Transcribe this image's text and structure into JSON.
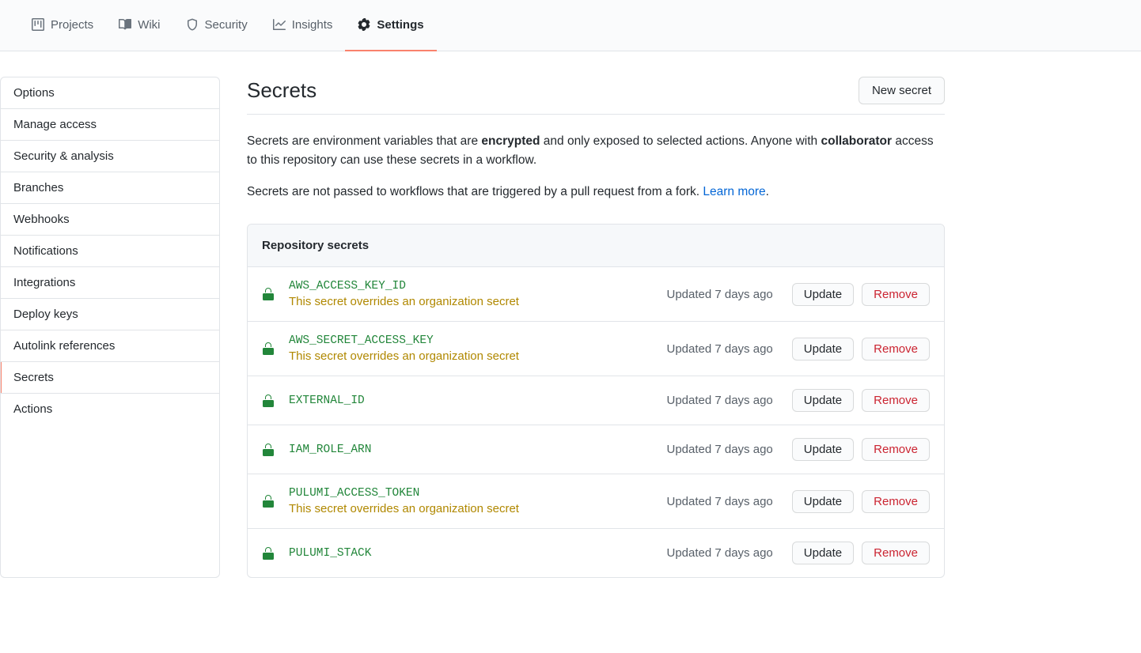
{
  "topnav": {
    "tabs": [
      {
        "label": "Projects",
        "icon": "project-icon"
      },
      {
        "label": "Wiki",
        "icon": "book-icon"
      },
      {
        "label": "Security",
        "icon": "shield-icon"
      },
      {
        "label": "Insights",
        "icon": "graph-icon"
      },
      {
        "label": "Settings",
        "icon": "gear-icon"
      }
    ],
    "active_index": 4
  },
  "sidebar": {
    "items": [
      "Options",
      "Manage access",
      "Security & analysis",
      "Branches",
      "Webhooks",
      "Notifications",
      "Integrations",
      "Deploy keys",
      "Autolink references",
      "Secrets",
      "Actions"
    ],
    "active_index": 9
  },
  "main": {
    "title": "Secrets",
    "new_button": "New secret",
    "desc1_parts": {
      "a": "Secrets are environment variables that are ",
      "b": "encrypted",
      "c": " and only exposed to selected actions. Anyone with ",
      "d": "collaborator",
      "e": " access to this repository can use these secrets in a workflow."
    },
    "desc2_parts": {
      "a": "Secrets are not passed to workflows that are triggered by a pull request from a fork. ",
      "link": "Learn more",
      "dot": "."
    },
    "box_header": "Repository secrets",
    "update_label": "Update",
    "remove_label": "Remove",
    "override_note": "This secret overrides an organization secret",
    "secrets": [
      {
        "name": "AWS_ACCESS_KEY_ID",
        "updated": "Updated 7 days ago",
        "override": true
      },
      {
        "name": "AWS_SECRET_ACCESS_KEY",
        "updated": "Updated 7 days ago",
        "override": true
      },
      {
        "name": "EXTERNAL_ID",
        "updated": "Updated 7 days ago",
        "override": false
      },
      {
        "name": "IAM_ROLE_ARN",
        "updated": "Updated 7 days ago",
        "override": false
      },
      {
        "name": "PULUMI_ACCESS_TOKEN",
        "updated": "Updated 7 days ago",
        "override": true
      },
      {
        "name": "PULUMI_STACK",
        "updated": "Updated 7 days ago",
        "override": false
      }
    ]
  }
}
